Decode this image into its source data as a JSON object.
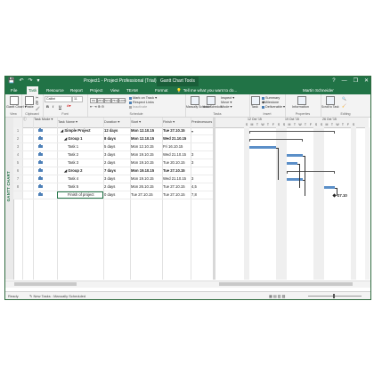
{
  "window": {
    "title": "Project1 - Project Professional (Trial)",
    "context_tab": "Gantt Chart Tools",
    "controls": [
      "?",
      "—",
      "❐",
      "✕"
    ],
    "quick_access": [
      "💾",
      "↶",
      "↷",
      "▾"
    ]
  },
  "ribbon_tabs": {
    "file": "File",
    "task": "Task",
    "resource": "Resource",
    "report": "Report",
    "project": "Project",
    "view": "View",
    "team": "TEAM",
    "format": "Format",
    "tell_me": "Tell me what you want to do...",
    "user": "Martin Schneider"
  },
  "ribbon": {
    "groups": [
      "View",
      "Clipboard",
      "Font",
      "Schedule",
      "Tasks",
      "Insert",
      "Properties",
      "Editing"
    ],
    "gantt_chart_label": "Gantt Chart ▾",
    "paste_label": "Paste",
    "font_name": "Calibri",
    "font_size": "11",
    "bold": "B",
    "italic": "I",
    "underline": "U",
    "pct": [
      "0%",
      "25%",
      "50%",
      "75%",
      "100%"
    ],
    "mark_on_track": "Mark on Track ▾",
    "respect_links": "Respect Links",
    "inactivate": "Inactivate",
    "manually_schedule": "Manually Schedule",
    "auto_schedule": "Auto Schedule",
    "inspect": "Inspect ▾",
    "move": "Move ▾",
    "mode": "Mode ▾",
    "task": "Task",
    "summary": "Summary",
    "milestone": "Milestone",
    "deliverable": "Deliverable ▾",
    "information": "Information",
    "scroll_to_task": "Scroll to Task"
  },
  "grid": {
    "headers": {
      "info": "ⓘ",
      "mode": "Task Mode ▾",
      "name": "Task Name ▾",
      "duration": "Duration ▾",
      "start": "Start ▾",
      "finish": "Finish ▾",
      "predecessors": "Predecessors ▾"
    },
    "rows": [
      {
        "num": "1",
        "name": "◢ Simple Project",
        "duration": "12 days",
        "start": "Mon 12.10.15",
        "finish": "Tue 27.10.15",
        "pred": "",
        "bold": true,
        "indent": 1
      },
      {
        "num": "2",
        "name": "◢ Group 1",
        "duration": "8 days",
        "start": "Mon 12.10.15",
        "finish": "Wed 21.10.15",
        "pred": "",
        "bold": true,
        "indent": 2
      },
      {
        "num": "3",
        "name": "Task 1",
        "duration": "5 days",
        "start": "Mon 12.10.15",
        "finish": "Fri 16.10.15",
        "pred": "",
        "bold": false,
        "indent": 3
      },
      {
        "num": "4",
        "name": "Task 2",
        "duration": "3 days",
        "start": "Mon 19.10.15",
        "finish": "Wed 21.10.15",
        "pred": "3",
        "bold": false,
        "indent": 3
      },
      {
        "num": "5",
        "name": "Task 3",
        "duration": "2 days",
        "start": "Mon 19.10.15",
        "finish": "Tue 20.10.15",
        "pred": "3",
        "bold": false,
        "indent": 3
      },
      {
        "num": "6",
        "name": "◢ Group 2",
        "duration": "7 days",
        "start": "Mon 19.10.15",
        "finish": "Tue 27.10.15",
        "pred": "",
        "bold": true,
        "indent": 2
      },
      {
        "num": "7",
        "name": "Task 4",
        "duration": "3 days",
        "start": "Mon 19.10.15",
        "finish": "Wed 21.10.15",
        "pred": "3",
        "bold": false,
        "indent": 3
      },
      {
        "num": "8",
        "name": "Task 5",
        "duration": "2 days",
        "start": "Mon 26.10.15",
        "finish": "Tue 27.10.15",
        "pred": "4,5",
        "bold": false,
        "indent": 3
      },
      {
        "num": "9",
        "name": "Finish of project",
        "duration": "0 days",
        "start": "Tue 27.10.15",
        "finish": "Tue 27.10.15",
        "pred": "7,8",
        "bold": false,
        "indent": 3
      }
    ]
  },
  "chart": {
    "weeks": [
      "12 Oct '15",
      "19 Oct '15",
      "26 Oct '15"
    ],
    "day_letters": [
      "S",
      "M",
      "T",
      "W",
      "T",
      "F",
      "S",
      "S",
      "M",
      "T",
      "W",
      "T",
      "F",
      "S",
      "S",
      "M",
      "T",
      "W",
      "T",
      "F",
      "S"
    ],
    "milestone_label": "27.10"
  },
  "sidebar": {
    "label": "GANTT CHART"
  },
  "status": {
    "ready": "Ready",
    "new_tasks": "New Tasks : Manually Scheduled"
  }
}
